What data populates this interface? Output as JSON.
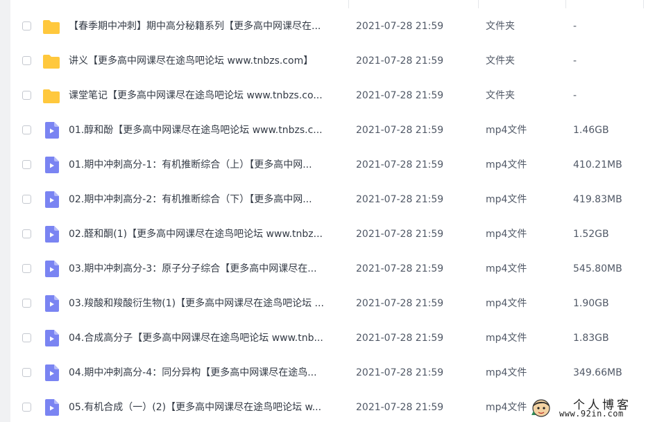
{
  "colors": {
    "folder": "#ffc83d",
    "video": "#7a84f2",
    "accent": "#5b6cf0"
  },
  "files": [
    {
      "name": "【春季期中冲刺】期中高分秘籍系列【更多高中网课尽在...",
      "date": "2021-07-28 21:59",
      "type": "文件夹",
      "size": "-",
      "icon": "folder-icon"
    },
    {
      "name": "讲义【更多高中网课尽在途鸟吧论坛 www.tnbzs.com】",
      "date": "2021-07-28 21:59",
      "type": "文件夹",
      "size": "-",
      "icon": "folder-icon"
    },
    {
      "name": "课堂笔记【更多高中网课尽在途鸟吧论坛 www.tnbzs.co...",
      "date": "2021-07-28 21:59",
      "type": "文件夹",
      "size": "-",
      "icon": "folder-icon"
    },
    {
      "name": "01.醇和酚【更多高中网课尽在途鸟吧论坛 www.tnbzs.c...",
      "date": "2021-07-28 21:59",
      "type": "mp4文件",
      "size": "1.46GB",
      "icon": "video-file-icon"
    },
    {
      "name": "01.期中冲刺高分-1：有机推断综合（上）【更多高中网...",
      "date": "2021-07-28 21:59",
      "type": "mp4文件",
      "size": "410.21MB",
      "icon": "video-file-icon"
    },
    {
      "name": "02.期中冲刺高分-2：有机推断综合（下）【更多高中网...",
      "date": "2021-07-28 21:59",
      "type": "mp4文件",
      "size": "419.83MB",
      "icon": "video-file-icon"
    },
    {
      "name": "02.醛和酮(1)【更多高中网课尽在途鸟吧论坛 www.tnbz...",
      "date": "2021-07-28 21:59",
      "type": "mp4文件",
      "size": "1.52GB",
      "icon": "video-file-icon"
    },
    {
      "name": "03.期中冲刺高分-3：原子分子综合【更多高中网课尽在...",
      "date": "2021-07-28 21:59",
      "type": "mp4文件",
      "size": "545.80MB",
      "icon": "video-file-icon"
    },
    {
      "name": "03.羧酸和羧酸衍生物(1)【更多高中网课尽在途鸟吧论坛 ...",
      "date": "2021-07-28 21:59",
      "type": "mp4文件",
      "size": "1.90GB",
      "icon": "video-file-icon"
    },
    {
      "name": "04.合成高分子【更多高中网课尽在途鸟吧论坛 www.tnb...",
      "date": "2021-07-28 21:59",
      "type": "mp4文件",
      "size": "1.83GB",
      "icon": "video-file-icon"
    },
    {
      "name": "04.期中冲刺高分-4：同分异构【更多高中网课尽在途鸟...",
      "date": "2021-07-28 21:59",
      "type": "mp4文件",
      "size": "349.66MB",
      "icon": "video-file-icon"
    },
    {
      "name": "05.有机合成（一）(2)【更多高中网课尽在途鸟吧论坛 w...",
      "date": "2021-07-28 21:59",
      "type": "mp4文件",
      "size": "",
      "icon": "video-file-icon"
    }
  ],
  "watermark": {
    "title": "个人博客",
    "url": "www.92in.com"
  }
}
